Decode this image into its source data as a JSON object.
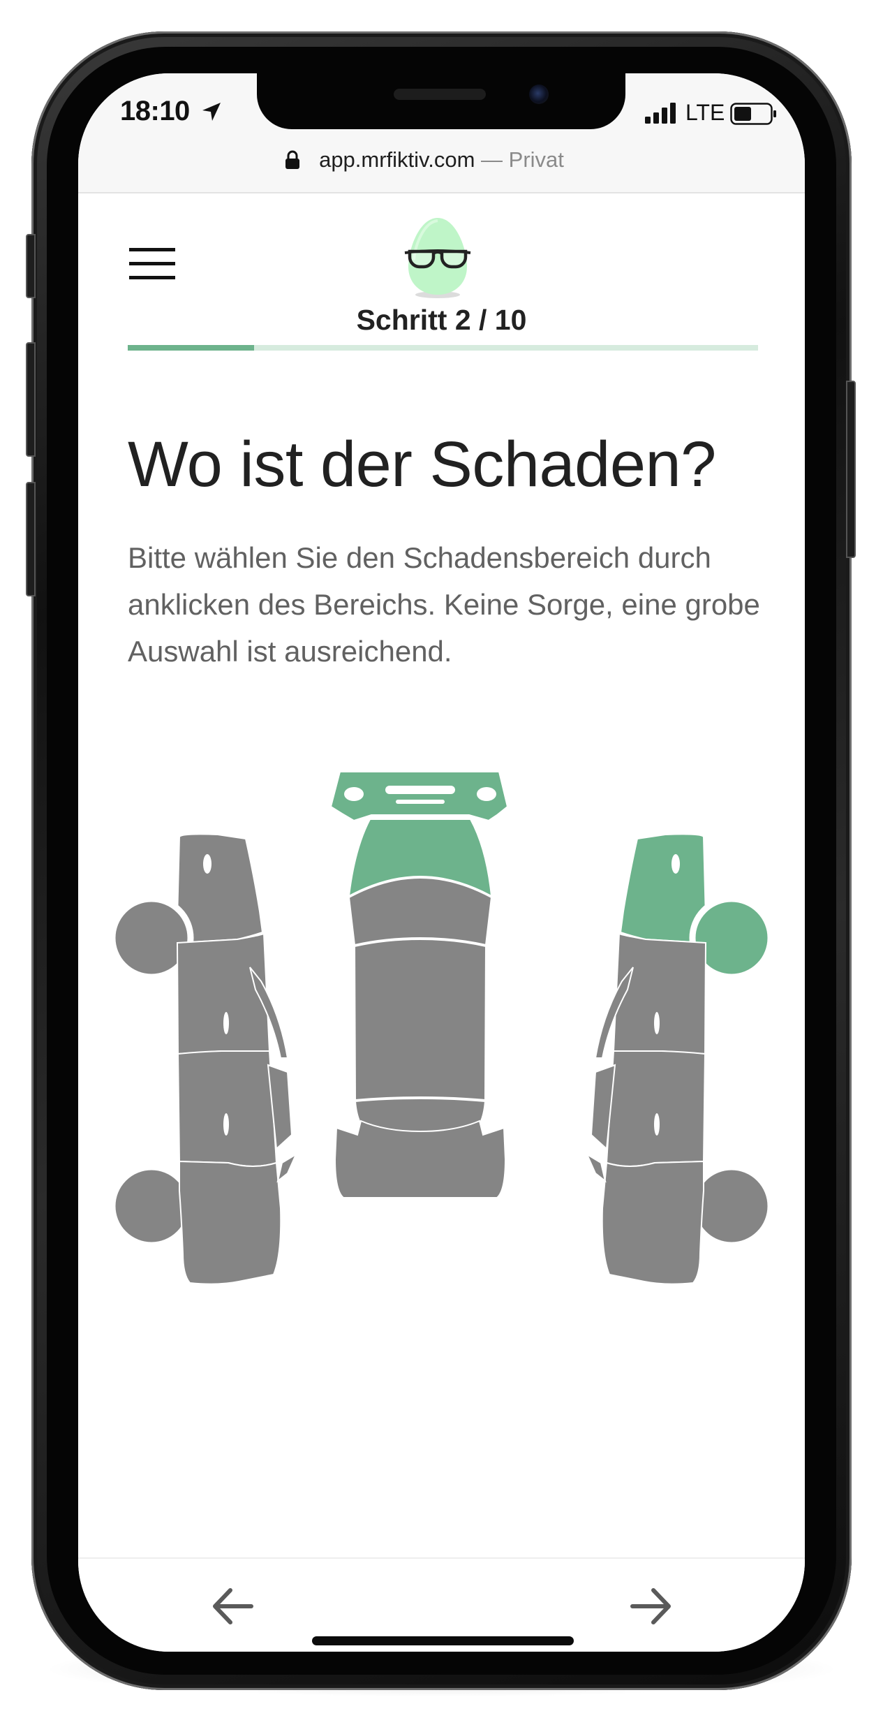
{
  "status_bar": {
    "time": "18:10",
    "network": "LTE",
    "icons": [
      "location-arrow-icon",
      "signal-icon",
      "battery-icon"
    ]
  },
  "browser": {
    "url_host": "app.mrfiktiv.com",
    "url_separator": " — ",
    "url_mode": "Privat"
  },
  "header": {
    "menu_icon": "hamburger-menu-icon",
    "logo_icon": "egg-with-glasses-logo",
    "step_label": "Schritt 2 / 10",
    "progress": {
      "current": 2,
      "total": 10,
      "fraction": 0.2
    }
  },
  "main": {
    "title": "Wo ist der Schaden?",
    "description": "Bitte wählen Sie den Schadensbereich durch anklicken des Bereichs. Keine Sorge, eine grobe Auswahl ist ausreichend."
  },
  "damage_selector": {
    "selected_parts": [
      "front-bumper",
      "hood",
      "right-front-fender",
      "right-front-wheel"
    ],
    "colors": {
      "selected": "#6db38c",
      "unselected": "#858585",
      "outline": "#ffffff"
    }
  },
  "navigation": {
    "back_icon": "arrow-left-icon",
    "next_icon": "arrow-right-icon"
  },
  "colors": {
    "accent": "#6db38c",
    "progress_track": "#d6ebde",
    "text_primary": "#212121",
    "text_secondary": "#616161"
  }
}
